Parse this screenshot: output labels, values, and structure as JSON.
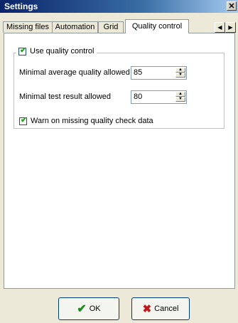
{
  "window": {
    "title": "Settings"
  },
  "tabs": [
    {
      "label": "Missing files"
    },
    {
      "label": "Automation"
    },
    {
      "label": "Grid"
    },
    {
      "label": "Quality control"
    }
  ],
  "quality_group": {
    "use_quality_control_label": "Use quality control",
    "use_quality_control_checked": true,
    "min_avg_quality_label": "Minimal average quality allowed",
    "min_avg_quality_value": "85",
    "min_test_result_label": "Minimal test result allowed",
    "min_test_result_value": "80",
    "warn_missing_label": "Warn on missing quality check data",
    "warn_missing_checked": true
  },
  "buttons": {
    "ok": "OK",
    "cancel": "Cancel"
  },
  "icons": {
    "close": "close-icon",
    "scroll_left": "arrow-left-icon",
    "scroll_right": "arrow-right-icon",
    "ok": "checkmark-icon",
    "cancel": "x-icon"
  }
}
